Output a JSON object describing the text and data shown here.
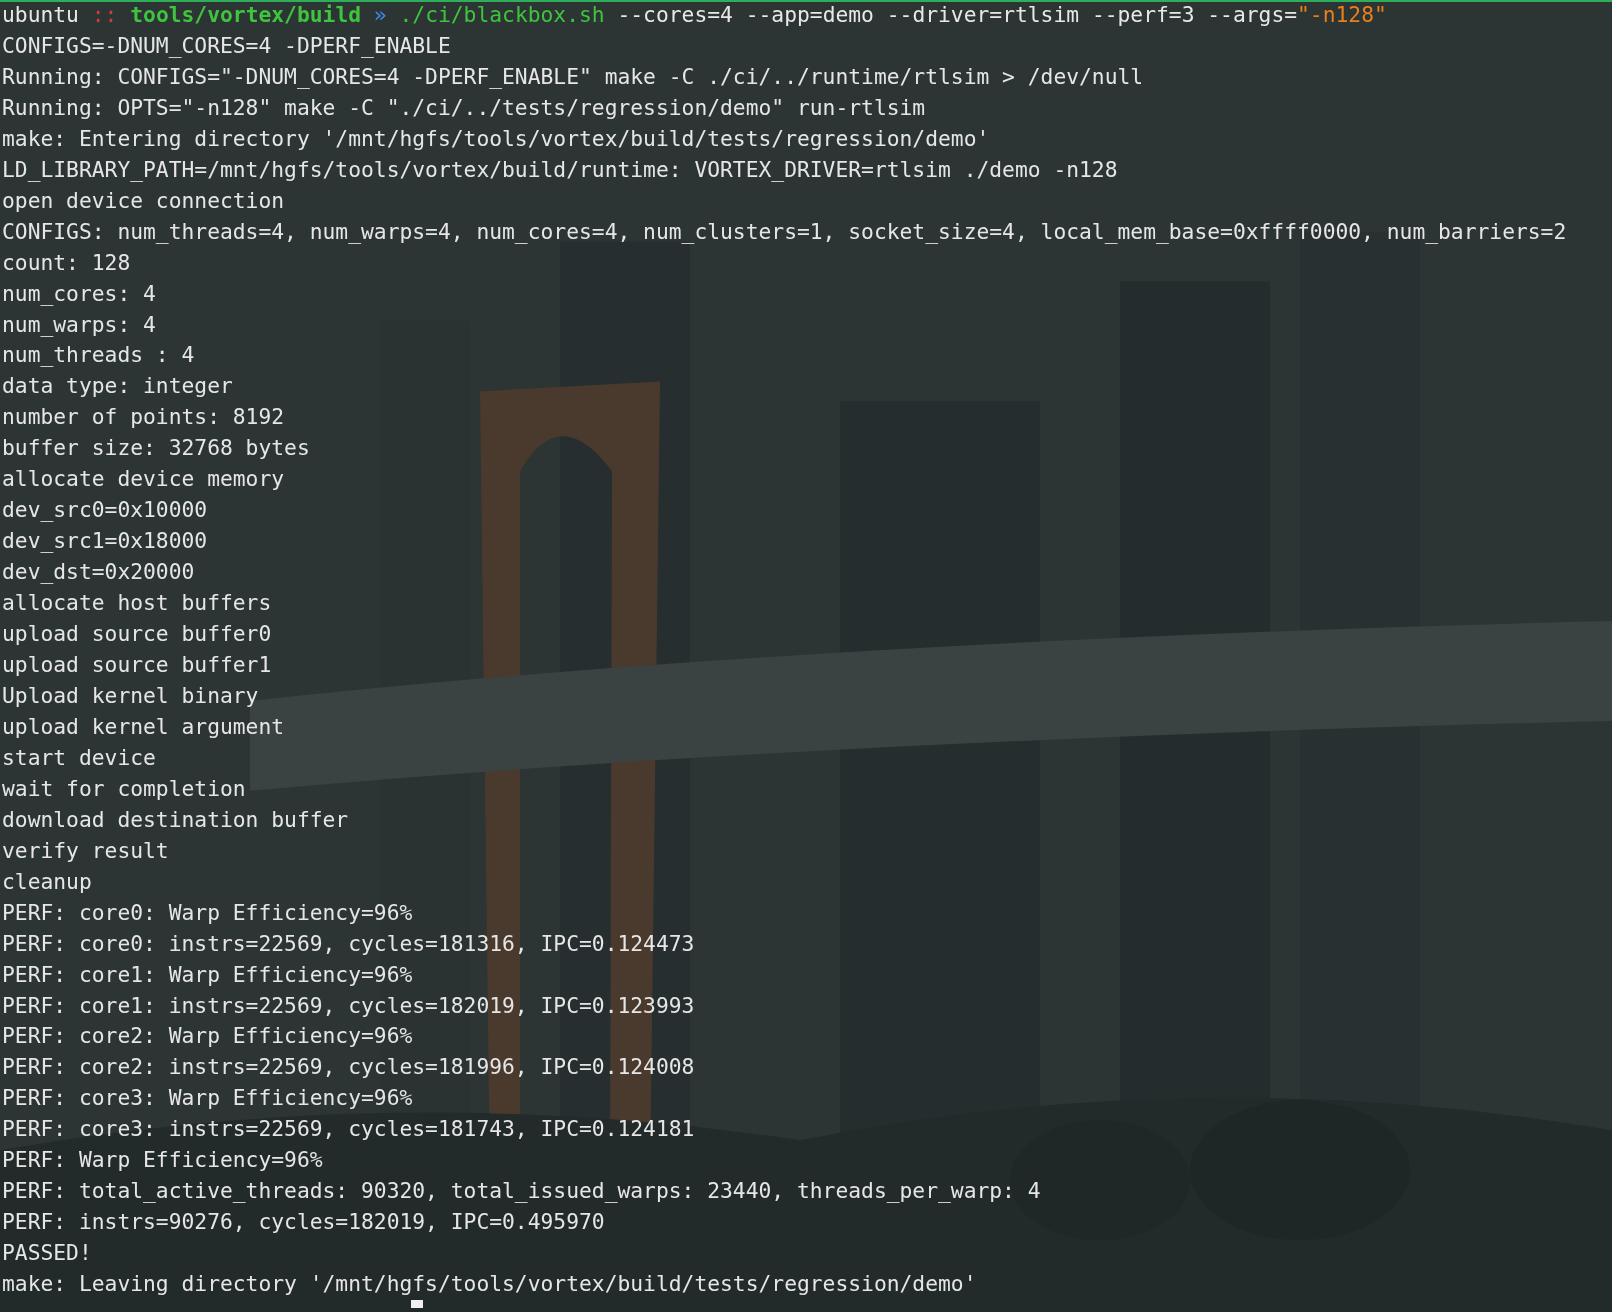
{
  "prompt": [
    {
      "kind": "user",
      "text": "ubuntu"
    },
    {
      "kind": "separator",
      "text": " :: "
    },
    {
      "kind": "path",
      "text": "tools/vortex/build"
    },
    {
      "kind": "arrow",
      "text": " » "
    },
    {
      "kind": "command",
      "text": "./ci/blackbox.sh"
    },
    {
      "kind": "args",
      "text": " --cores=4 --app=demo --driver=rtlsim --perf=3 --args="
    },
    {
      "kind": "string",
      "text": "\"-n128\""
    }
  ],
  "lines": [
    "CONFIGS=-DNUM_CORES=4 -DPERF_ENABLE",
    "Running: CONFIGS=\"-DNUM_CORES=4 -DPERF_ENABLE\" make -C ./ci/../runtime/rtlsim > /dev/null",
    "Running: OPTS=\"-n128\" make -C \"./ci/../tests/regression/demo\" run-rtlsim",
    "make: Entering directory '/mnt/hgfs/tools/vortex/build/tests/regression/demo'",
    "LD_LIBRARY_PATH=/mnt/hgfs/tools/vortex/build/runtime: VORTEX_DRIVER=rtlsim ./demo -n128",
    "open device connection",
    "CONFIGS: num_threads=4, num_warps=4, num_cores=4, num_clusters=1, socket_size=4, local_mem_base=0xffff0000, num_barriers=2",
    "count: 128",
    "num_cores: 4",
    "num_warps: 4",
    "num_threads : 4",
    "data type: integer",
    "number of points: 8192",
    "buffer size: 32768 bytes",
    "allocate device memory",
    "dev_src0=0x10000",
    "dev_src1=0x18000",
    "dev_dst=0x20000",
    "allocate host buffers",
    "upload source buffer0",
    "upload source buffer1",
    "Upload kernel binary",
    "upload kernel argument",
    "start device",
    "wait for completion",
    "download destination buffer",
    "verify result",
    "cleanup",
    "PERF: core0: Warp Efficiency=96%",
    "PERF: core0: instrs=22569, cycles=181316, IPC=0.124473",
    "PERF: core1: Warp Efficiency=96%",
    "PERF: core1: instrs=22569, cycles=182019, IPC=0.123993",
    "PERF: core2: Warp Efficiency=96%",
    "PERF: core2: instrs=22569, cycles=181996, IPC=0.124008",
    "PERF: core3: Warp Efficiency=96%",
    "PERF: core3: instrs=22569, cycles=181743, IPC=0.124181",
    "PERF: Warp Efficiency=96%",
    "PERF: total_active_threads: 90320, total_issued_warps: 23440, threads_per_warp: 4",
    "PERF: instrs=90276, cycles=182019, IPC=0.495970",
    "PASSED!",
    "make: Leaving directory '/mnt/hgfs/tools/vortex/build/tests/regression/demo'"
  ]
}
